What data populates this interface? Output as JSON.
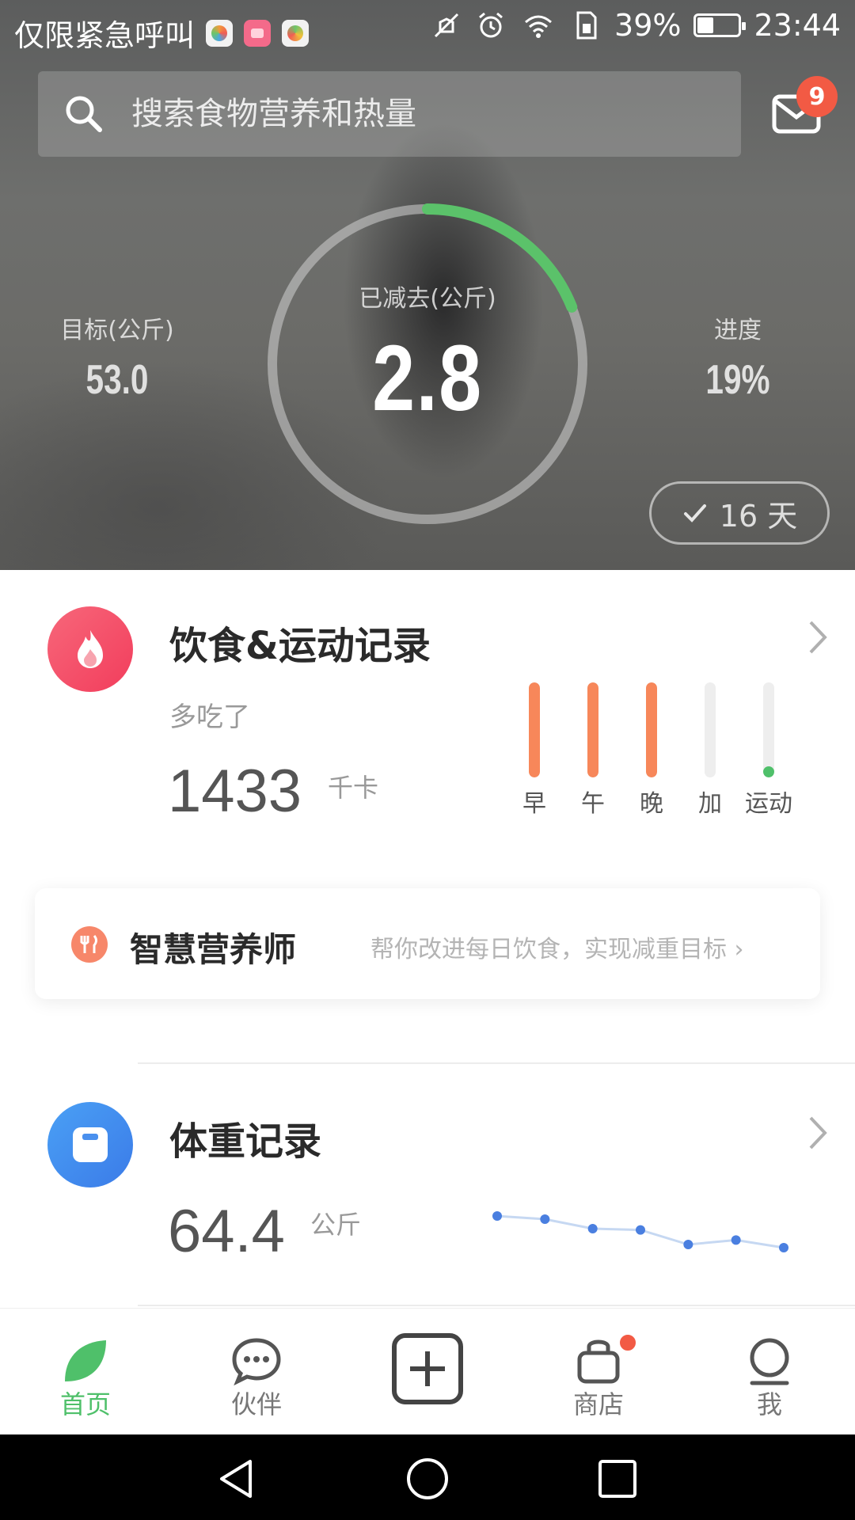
{
  "status_bar": {
    "carrier": "仅限紧急呼叫",
    "battery_percent": "39%",
    "battery_level": 0.39,
    "time": "23:44"
  },
  "search": {
    "placeholder": "搜索食物营养和热量"
  },
  "messages": {
    "badge_count": "9"
  },
  "progress": {
    "target_label": "目标(公斤)",
    "target_value": "53.0",
    "lost_label": "已减去(公斤)",
    "lost_value": "2.8",
    "progress_label": "进度",
    "progress_value": "19%",
    "progress_fraction": 0.19,
    "days_text": "16 天"
  },
  "diet_card": {
    "title": "饮食&运动记录",
    "status_label": "多吃了",
    "calories": "1433",
    "unit": "千卡",
    "meals": [
      {
        "label": "早",
        "fill": 1.0,
        "color": "#f7875a"
      },
      {
        "label": "午",
        "fill": 1.0,
        "color": "#f7875a"
      },
      {
        "label": "晚",
        "fill": 1.0,
        "color": "#f7875a"
      },
      {
        "label": "加",
        "fill": 0.0,
        "color": "#f7875a"
      },
      {
        "label": "运动",
        "fill": 0.12,
        "color": "#4fc06a"
      }
    ]
  },
  "nutritionist": {
    "title": "智慧营养师",
    "subtitle": "帮你改进每日饮食，实现减重目标 ›"
  },
  "weight_card": {
    "title": "体重记录",
    "value": "64.4",
    "unit": "公斤",
    "trend": [
      64.9,
      64.85,
      64.7,
      64.68,
      64.45,
      64.52,
      64.4
    ]
  },
  "bottom_nav": [
    {
      "label": "首页",
      "active": true
    },
    {
      "label": "伙伴",
      "active": false
    },
    {
      "label": "",
      "active": false
    },
    {
      "label": "商店",
      "active": false
    },
    {
      "label": "我",
      "active": false
    }
  ],
  "colors": {
    "accent_green": "#4fc06a",
    "accent_orange": "#f7875a",
    "badge_red": "#f25a44",
    "diet_icon": "#f24d6a",
    "weight_icon": "#3d8ef0"
  }
}
